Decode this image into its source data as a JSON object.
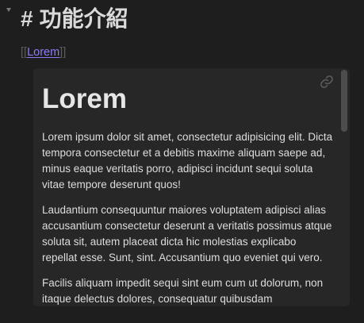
{
  "heading": {
    "hash": "#",
    "title": "功能介紹"
  },
  "wikilink": {
    "open": "[[",
    "text": "Lorem",
    "close": "]]"
  },
  "embed": {
    "title": "Lorem",
    "paragraphs": [
      "Lorem ipsum dolor sit amet, consectetur adipisicing elit. Dicta tempora consectetur et a debitis maxime aliquam saepe ad, minus eaque veritatis porro, adipisci incidunt sequi soluta vitae tempore deserunt quos!",
      "Laudantium consequuntur maiores voluptatem adipisci alias accusantium consectetur deserunt a veritatis possimus atque soluta sit, autem placeat dicta hic molestias explicabo repellat esse. Sunt, sint. Accusantium quo eveniet qui vero.",
      "Facilis aliquam impedit sequi sint eum cum ut dolorum, non itaque delectus dolores, consequatur quibusdam"
    ],
    "link_icon": "link-icon"
  },
  "colors": {
    "background": "#1e1e1e",
    "embed_background": "#272727",
    "accent": "#8b7cf6",
    "text": "#dcddde"
  }
}
